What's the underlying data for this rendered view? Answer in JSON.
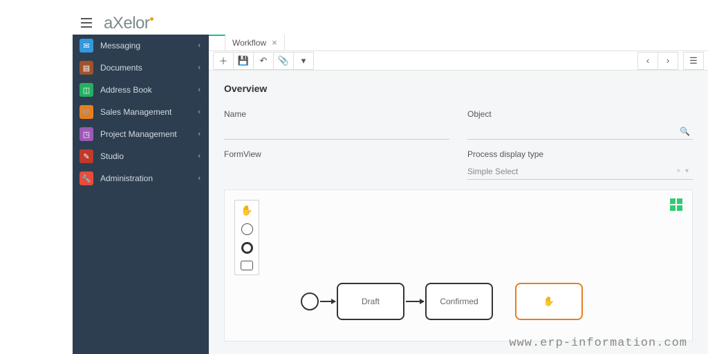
{
  "brand": {
    "name": "axelor"
  },
  "sidebar": {
    "items": [
      {
        "label": "Messaging",
        "color": "#3498db",
        "glyph": "✉"
      },
      {
        "label": "Documents",
        "color": "#a0522d",
        "glyph": "▥"
      },
      {
        "label": "Address Book",
        "color": "#27ae60",
        "glyph": "▭"
      },
      {
        "label": "Sales Management",
        "color": "#e67e22",
        "glyph": "🛒"
      },
      {
        "label": "Project Management",
        "color": "#9b59b6",
        "glyph": "◳"
      },
      {
        "label": "Studio",
        "color": "#c0392b",
        "glyph": "✎"
      },
      {
        "label": "Administration",
        "color": "#e74c3c",
        "glyph": "🔧"
      }
    ]
  },
  "tabs": [
    {
      "label": "Workflow"
    }
  ],
  "overview": {
    "title": "Overview",
    "name_label": "Name",
    "object_label": "Object",
    "formview_label": "FormView",
    "process_label": "Process display type",
    "process_value": "Simple Select"
  },
  "workflow": {
    "nodes": [
      {
        "label": "Draft"
      },
      {
        "label": "Confirmed"
      },
      {
        "label": ""
      }
    ]
  },
  "watermark": "www.erp-information.com"
}
